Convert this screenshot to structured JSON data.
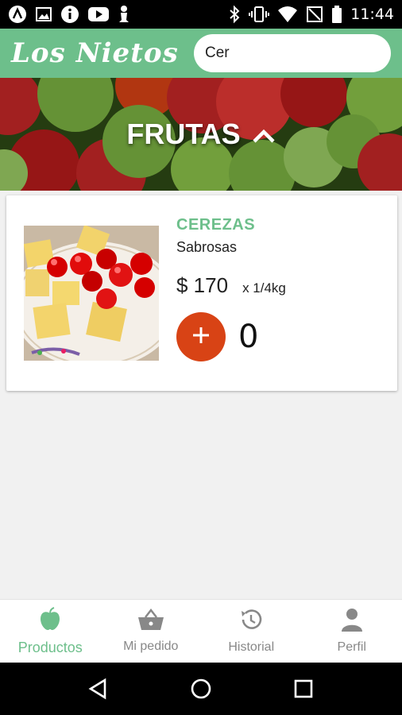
{
  "status_bar": {
    "time": "11:44",
    "left_icons": [
      "a-launcher-icon",
      "image-icon",
      "info-icon",
      "youtube-icon",
      "pawn-icon"
    ],
    "right_icons": [
      "bluetooth-icon",
      "vibrate-icon",
      "wifi-icon",
      "no-signal-icon",
      "battery-icon"
    ]
  },
  "app_bar": {
    "brand": "Los Nietos",
    "search_value": "Cer",
    "search_icon": "search-icon"
  },
  "banner": {
    "title": "FRUTAS",
    "toggle_icon": "chevron-up-icon"
  },
  "product": {
    "name": "CEREZAS",
    "subtitle": "Sabrosas",
    "price": "$ 170",
    "unit": "x 1/4kg",
    "quantity": "0",
    "add_icon": "plus-icon"
  },
  "bottom_nav": {
    "items": [
      {
        "label": "Productos",
        "icon": "apple-icon",
        "active": true
      },
      {
        "label": "Mi pedido",
        "icon": "basket-icon",
        "active": false
      },
      {
        "label": "Historial",
        "icon": "history-icon",
        "active": false
      },
      {
        "label": "Perfil",
        "icon": "person-icon",
        "active": false
      }
    ]
  },
  "colors": {
    "primary": "#6dbf8b",
    "accent": "#d84315",
    "inactive": "#888888"
  }
}
